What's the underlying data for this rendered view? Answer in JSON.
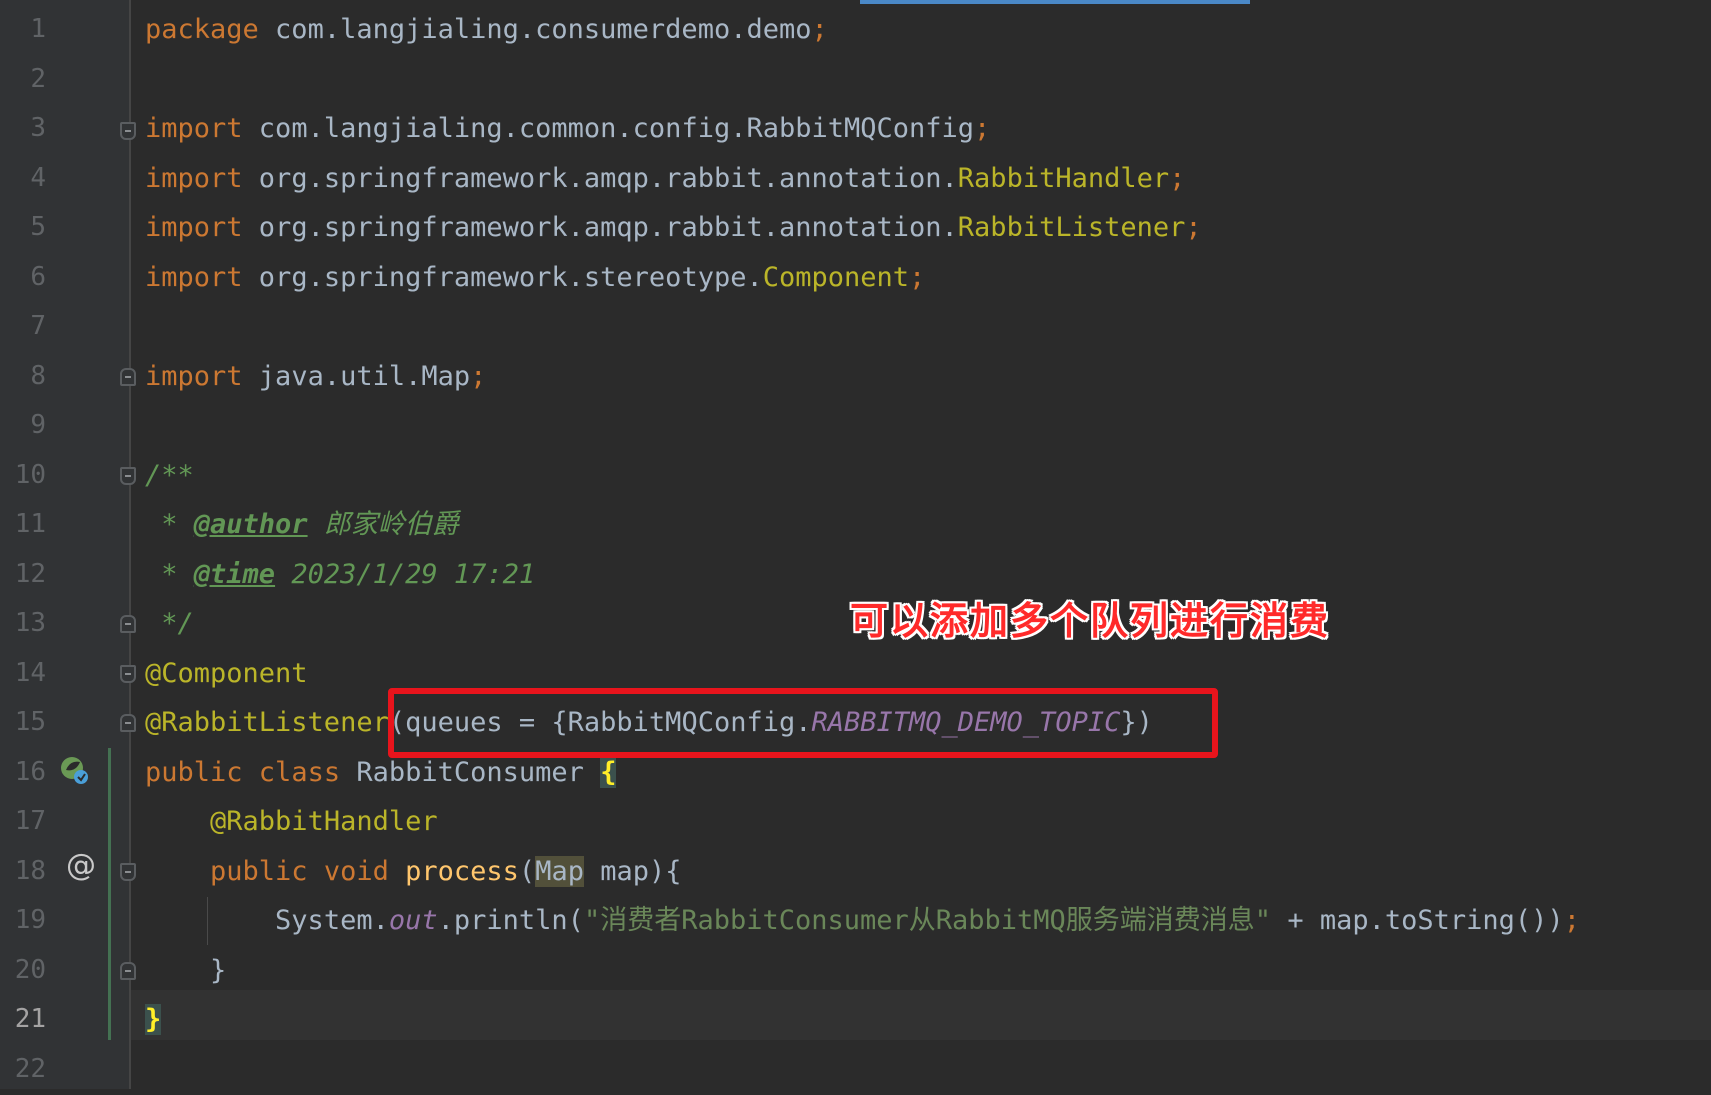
{
  "editor": {
    "current_line": 21,
    "line_numbers": [
      "1",
      "2",
      "3",
      "4",
      "5",
      "6",
      "7",
      "8",
      "9",
      "10",
      "11",
      "12",
      "13",
      "14",
      "15",
      "16",
      "17",
      "18",
      "19",
      "20",
      "21",
      "22"
    ],
    "lines": {
      "l1": {
        "kw": "package",
        "rest": " com.langjialing.consumerdemo.demo",
        "semi": ";"
      },
      "l3": {
        "kw": "import",
        "rest": " com.langjialing.common.config.RabbitMQConfig",
        "semi": ";"
      },
      "l4": {
        "kw": "import",
        "rest": " org.springframework.amqp.rabbit.annotation.",
        "cls": "RabbitHandler",
        "semi": ";"
      },
      "l5": {
        "kw": "import",
        "rest": " org.springframework.amqp.rabbit.annotation.",
        "cls": "RabbitListener",
        "semi": ";"
      },
      "l6": {
        "kw": "import",
        "rest": " org.springframework.stereotype.",
        "cls": "Component",
        "semi": ";"
      },
      "l8": {
        "kw": "import",
        "rest": " java.util.Map",
        "semi": ";"
      },
      "l10": {
        "cmt": "/**"
      },
      "l11": {
        "prefix": " * ",
        "tag": "@author",
        "text": " 郎家岭伯爵"
      },
      "l12": {
        "prefix": " * ",
        "tag": "@time",
        "text": " 2023/1/29 17:21"
      },
      "l13": {
        "cmt": " */"
      },
      "l14": {
        "ann": "@Component"
      },
      "l15": {
        "ann": "@RabbitListener",
        "open": "(queues = {RabbitMQConfig.",
        "konst": "RABBITMQ_DEMO_TOPIC",
        "close": "})"
      },
      "l16": {
        "kw1": "public",
        "kw2": " class",
        "name": " RabbitConsumer ",
        "brace": "{"
      },
      "l17": {
        "indent": "    ",
        "ann": "@RabbitHandler"
      },
      "l18": {
        "indent": "    ",
        "kw1": "public",
        "kw2": " void",
        "sp": " ",
        "fn": "process",
        "p1": "(",
        "type": "Map",
        "p2": " map){"
      },
      "l19": {
        "indent": "        ",
        "a": "System.",
        "konst": "out",
        "b": ".println(",
        "str": "\"消费者RabbitConsumer从RabbitMQ服务端消费消息\"",
        "c": " + map.toString())",
        "semi": ";"
      },
      "l20": {
        "indent": "    ",
        "text": "}"
      },
      "l21": {
        "brace": "}"
      }
    }
  },
  "annotation_text": "可以添加多个队列进行消费",
  "colors": {
    "background": "#2b2b2b",
    "keyword": "#cc7832",
    "annotation": "#bbb529",
    "comment": "#629755",
    "string": "#6a8759",
    "constant": "#9876aa",
    "function": "#ffc66d",
    "highlight_box": "#e8141c"
  },
  "icons": [
    "spring-bean-icon",
    "implements-at-icon",
    "fold-icon"
  ]
}
